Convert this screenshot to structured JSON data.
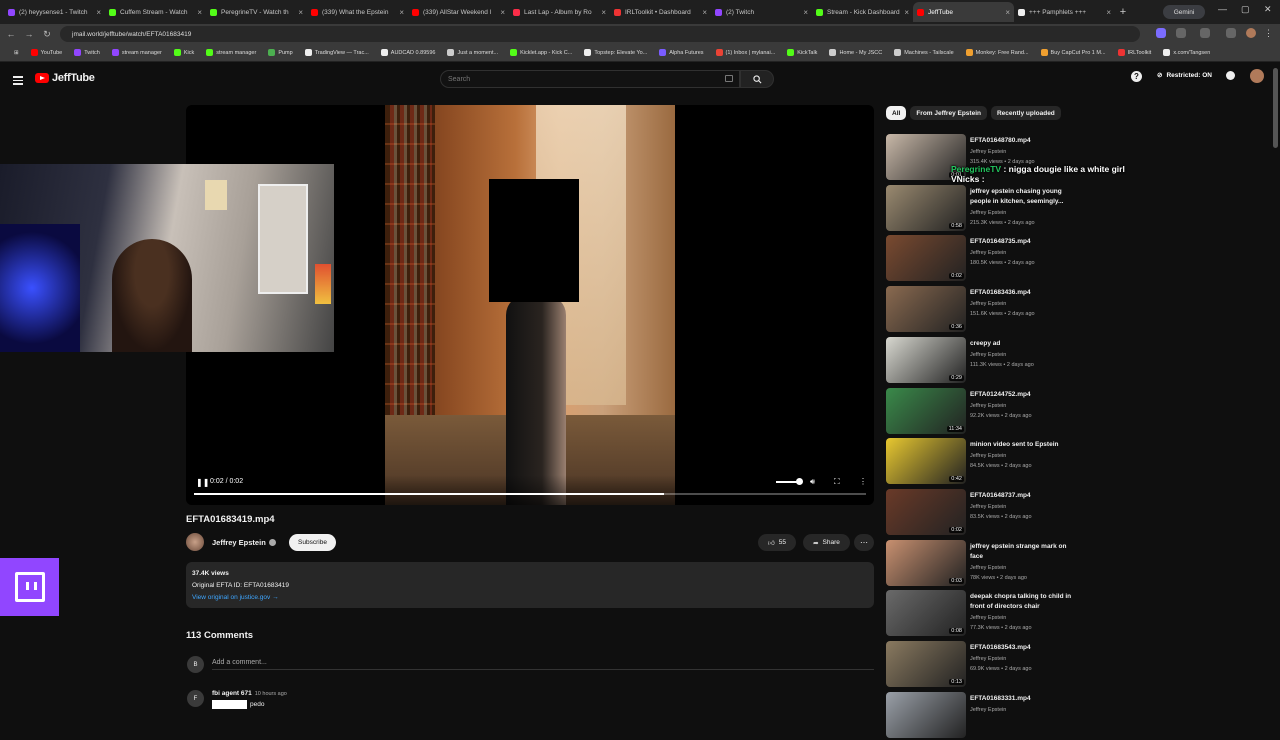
{
  "browser": {
    "tabs": [
      {
        "label": "(2) heyysense1 - Twitch",
        "color": "#9146ff"
      },
      {
        "label": "Cuffem Stream - Watch",
        "color": "#53fc18"
      },
      {
        "label": "PeregrineTV - Watch th",
        "color": "#53fc18"
      },
      {
        "label": "(339) What the Epstein",
        "color": "#ff0000"
      },
      {
        "label": "(339) AllStar Weekend l",
        "color": "#ff0000"
      },
      {
        "label": "Last Lap - Album by Ro",
        "color": "#fa2d48"
      },
      {
        "label": "IRLToolkit • Dashboard",
        "color": "#e33"
      },
      {
        "label": "(2) Twitch",
        "color": "#9146ff"
      },
      {
        "label": "Stream - Kick Dashboard",
        "color": "#53fc18"
      },
      {
        "label": "JeffTube",
        "color": "#ff0000"
      },
      {
        "label": "+++ Pamphlets +++",
        "color": "#eee"
      }
    ],
    "gemini": "Gemini",
    "url": "jmail.world/jefftube/watch/EFTA01683419",
    "bookmarks": [
      {
        "label": "YouTube",
        "color": "#ff0000"
      },
      {
        "label": "Twitch",
        "color": "#9146ff"
      },
      {
        "label": "stream manager",
        "color": "#9146ff"
      },
      {
        "label": "Kick",
        "color": "#53fc18"
      },
      {
        "label": "stream manager",
        "color": "#53fc18"
      },
      {
        "label": "Pump",
        "color": "#4caf50"
      },
      {
        "label": "TradingView — Trac...",
        "color": "#eee"
      },
      {
        "label": "AUDCAD 0.89596",
        "color": "#eee"
      },
      {
        "label": "Just a moment...",
        "color": "#ccc"
      },
      {
        "label": "Kicklet.app - Kick C...",
        "color": "#53fc18"
      },
      {
        "label": "Topstep: Elevate Yo...",
        "color": "#eee"
      },
      {
        "label": "Alpha Futures",
        "color": "#7a5cff"
      },
      {
        "label": "(1) Inbox | mylanai...",
        "color": "#ea4335"
      },
      {
        "label": "KickTalk",
        "color": "#53fc18"
      },
      {
        "label": "Home - My JSCC",
        "color": "#ccc"
      },
      {
        "label": "Machines - Tailscale",
        "color": "#ccc"
      },
      {
        "label": "Monkey: Free Rand...",
        "color": "#f0a030"
      },
      {
        "label": "Buy CapCut Pro 1 M...",
        "color": "#f0a030"
      },
      {
        "label": "IRLToolkit",
        "color": "#e33"
      },
      {
        "label": "x.com/Tangsen",
        "color": "#eee"
      }
    ]
  },
  "header": {
    "logo": "JeffTube",
    "search_placeholder": "Search",
    "restricted": "Restricted: ON"
  },
  "player": {
    "time": "0:02 / 0:02",
    "progress": 0.7
  },
  "video": {
    "title": "EFTA01683419.mp4",
    "channel": "Jeffrey Epstein",
    "subscribe": "Subscribe",
    "likes": "55",
    "share": "Share",
    "views": "37.4K views",
    "original_id": "Original EFTA ID: EFTA01683419",
    "link": "View original on justice.gov →"
  },
  "comments": {
    "count": "113 Comments",
    "add_placeholder": "Add a comment...",
    "add_avatar": "B",
    "first": {
      "avatar": "F",
      "author": "fbi agent 671",
      "ago": "10 hours ago",
      "text": "pedo"
    }
  },
  "sidebar": {
    "chips": [
      "All",
      "From Jeffrey Epstein",
      "Recently uploaded"
    ],
    "items": [
      {
        "title": "EFTA01648780.mp4",
        "channel": "Jeffrey Epstein",
        "meta": "315.4K views • 2 days ago",
        "duration": "0:01",
        "thumb": "#c8b8a8"
      },
      {
        "title": "jeffrey epstein chasing young people in kitchen, seemingly...",
        "channel": "Jeffrey Epstein",
        "meta": "215.3K views • 2 days ago",
        "duration": "0:58",
        "thumb": "#9a8a70"
      },
      {
        "title": "EFTA01648735.mp4",
        "channel": "Jeffrey Epstein",
        "meta": "180.5K views • 2 days ago",
        "duration": "0:02",
        "thumb": "#7a4a30"
      },
      {
        "title": "EFTA01683436.mp4",
        "channel": "Jeffrey Epstein",
        "meta": "151.6K views • 2 days ago",
        "duration": "0:36",
        "thumb": "#8a6a50"
      },
      {
        "title": "creepy ad",
        "channel": "Jeffrey Epstein",
        "meta": "111.3K views • 2 days ago",
        "duration": "0:29",
        "thumb": "#d8d8d0"
      },
      {
        "title": "EFTA01244752.mp4",
        "channel": "Jeffrey Epstein",
        "meta": "92.2K views • 2 days ago",
        "duration": "11:34",
        "thumb": "#3a8a4a"
      },
      {
        "title": "minion video sent to Epstein",
        "channel": "Jeffrey Epstein",
        "meta": "84.5K views • 2 days ago",
        "duration": "0:42",
        "thumb": "#e8c830"
      },
      {
        "title": "EFTA01648737.mp4",
        "channel": "Jeffrey Epstein",
        "meta": "83.5K views • 2 days ago",
        "duration": "0:02",
        "thumb": "#6a3a28"
      },
      {
        "title": "jeffrey epstein strange mark on face",
        "channel": "Jeffrey Epstein",
        "meta": "78K views • 2 days ago",
        "duration": "0:03",
        "thumb": "#c89070"
      },
      {
        "title": "deepak chopra talking to child in front of directors chair",
        "channel": "Jeffrey Epstein",
        "meta": "77.3K views • 2 days ago",
        "duration": "0:08",
        "thumb": "#6a6a6a"
      },
      {
        "title": "EFTA01683543.mp4",
        "channel": "Jeffrey Epstein",
        "meta": "69.9K views • 2 days ago",
        "duration": "0:13",
        "thumb": "#8a7a60"
      },
      {
        "title": "EFTA01683331.mp4",
        "channel": "Jeffrey Epstein",
        "meta": "",
        "duration": "",
        "thumb": "#9aa0a8"
      }
    ]
  },
  "chat_overlay": {
    "user1": "PeregrineTV",
    "msg1": ": nigga dougie like a white girl",
    "user2": "VNicks",
    "msg2": ":"
  }
}
